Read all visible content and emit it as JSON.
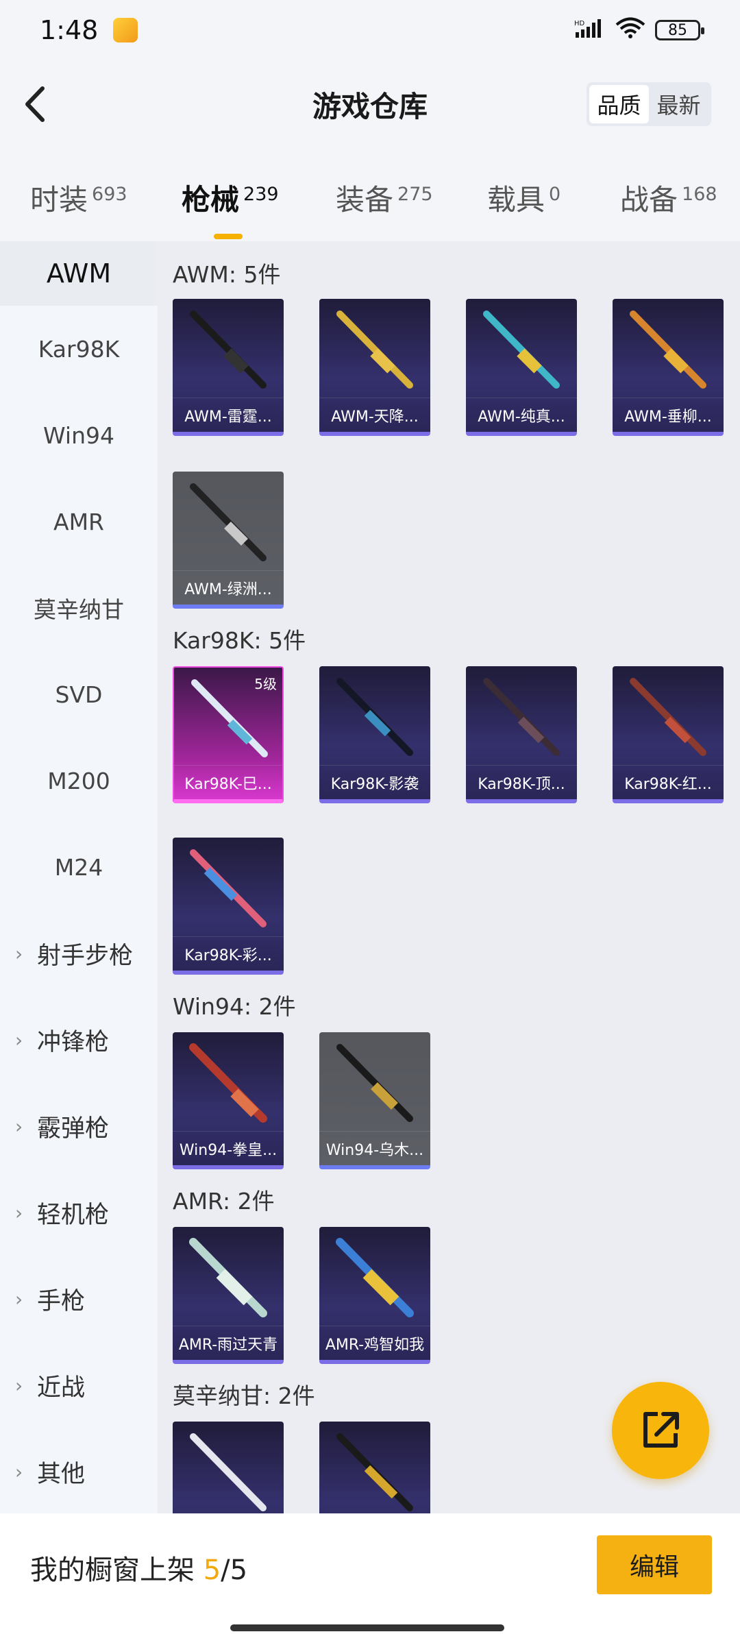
{
  "status_bar": {
    "time": "1:48",
    "battery": "85",
    "network_label": "HD"
  },
  "header": {
    "title": "游戏仓库",
    "sort_quality": "品质",
    "sort_latest": "最新"
  },
  "tabs": [
    {
      "label": "时装",
      "count": "693"
    },
    {
      "label": "枪械",
      "count": "239"
    },
    {
      "label": "装备",
      "count": "275"
    },
    {
      "label": "载具",
      "count": "0"
    },
    {
      "label": "战备",
      "count": "168"
    }
  ],
  "sidebar": {
    "items": [
      "AWM",
      "Kar98K",
      "Win94",
      "AMR",
      "莫辛纳甘",
      "SVD",
      "M200",
      "M24"
    ],
    "groups": [
      "射手步枪",
      "冲锋枪",
      "霰弹枪",
      "轻机枪",
      "手枪",
      "近战",
      "其他"
    ]
  },
  "sections": [
    {
      "title": "AWM: 5件",
      "items": [
        "AWM-雷霆...",
        "AWM-天降...",
        "AWM-纯真...",
        "AWM-垂柳...",
        "AWM-绿洲..."
      ]
    },
    {
      "title": "Kar98K: 5件",
      "items": [
        "Kar98K-巳...",
        "Kar98K-影袭",
        "Kar98K-顶...",
        "Kar98K-红...",
        "Kar98K-彩..."
      ],
      "level_badge": "5级"
    },
    {
      "title": "Win94: 2件",
      "items": [
        "Win94-拳皇...",
        "Win94-乌木..."
      ]
    },
    {
      "title": "AMR: 2件",
      "items": [
        "AMR-雨过天青",
        "AMR-鸡智如我"
      ]
    },
    {
      "title": "莫辛纳甘: 2件",
      "items": [
        "",
        ""
      ]
    }
  ],
  "bottom_bar": {
    "showcase_label": "我的橱窗上架",
    "showcase_current": "5",
    "showcase_total": "/5",
    "edit_label": "编辑"
  },
  "colors": {
    "accent": "#f6b100",
    "card_purple": "#34306c",
    "card_pink": "#d638cc"
  },
  "icons": [
    "back-icon",
    "signal-icon",
    "wifi-icon",
    "battery-icon",
    "share-icon",
    "chevron-right-icon",
    "rifle-icon"
  ]
}
